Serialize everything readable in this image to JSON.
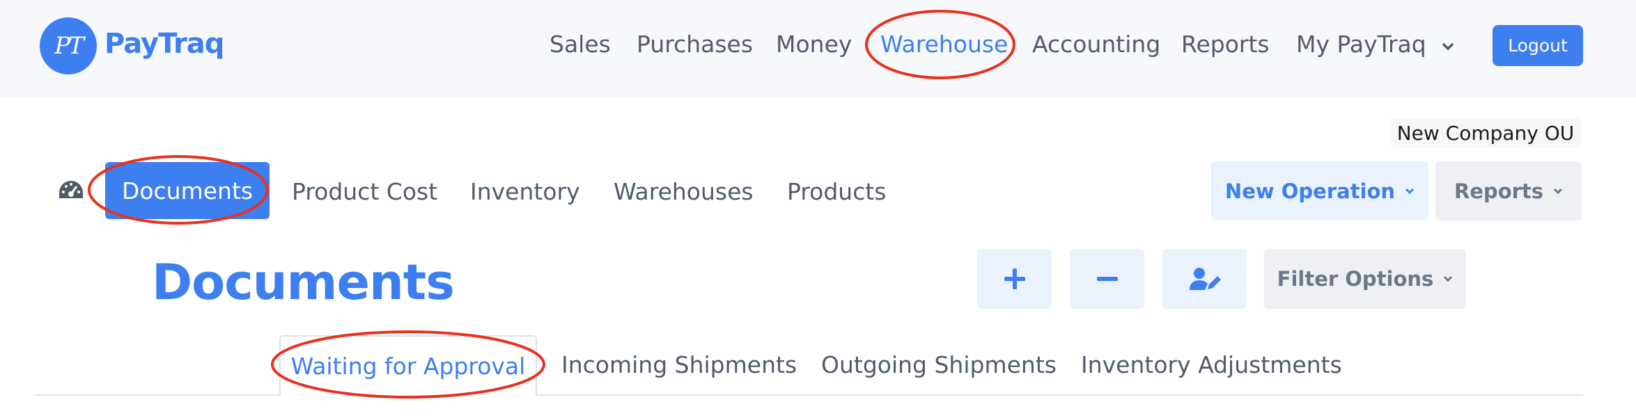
{
  "brand": {
    "logo_mark": "PT",
    "name": "PayTraq",
    "accent": "#3d7ef1"
  },
  "main_nav": {
    "items": [
      "Sales",
      "Purchases",
      "Money",
      "Warehouse",
      "Accounting",
      "Reports",
      "My PayTraq"
    ],
    "active": "Warehouse",
    "dropdown_icon": "chevron-down-icon"
  },
  "logout_label": "Logout",
  "company_label": "New Company OU",
  "sub_nav": {
    "dashboard_icon": "speedometer-icon",
    "items": [
      "Documents",
      "Product Cost",
      "Inventory",
      "Warehouses",
      "Products"
    ],
    "active": "Documents"
  },
  "actions": {
    "new_operation_label": "New Operation",
    "reports_label": "Reports"
  },
  "page_title": "Documents",
  "toolbar": {
    "add_icon": "plus-icon",
    "remove_icon": "minus-icon",
    "edit_user_icon": "user-edit-icon",
    "filter_label": "Filter Options"
  },
  "tabs": {
    "items": [
      "Waiting for Approval",
      "Incoming Shipments",
      "Outgoing Shipments",
      "Inventory Adjustments"
    ],
    "active": "Waiting for Approval"
  },
  "annotation_color": "#e8321e"
}
